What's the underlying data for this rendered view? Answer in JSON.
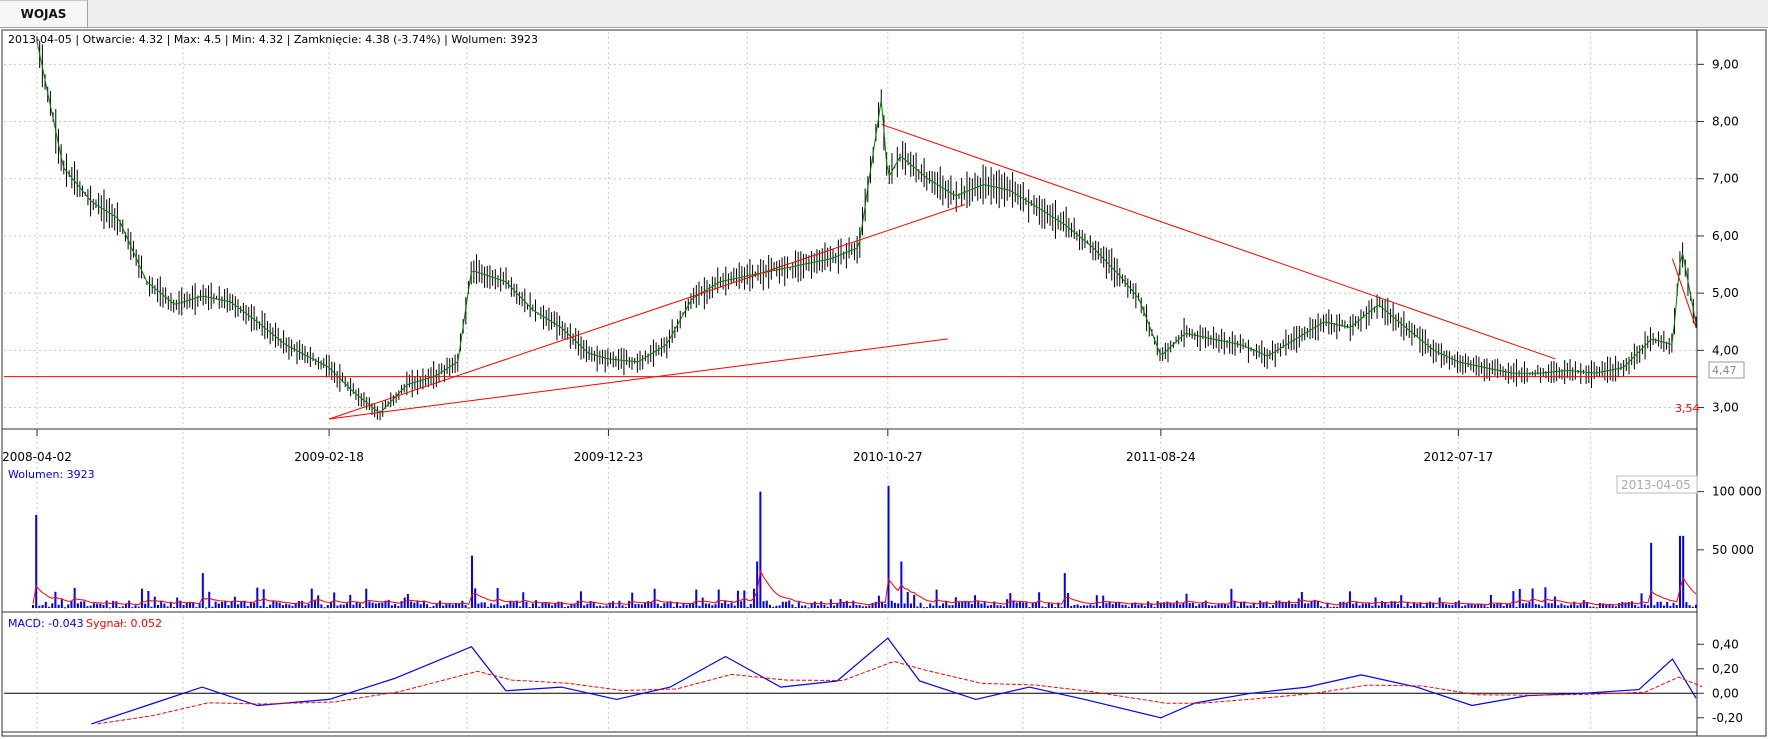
{
  "tab": {
    "label": "WOJAS"
  },
  "info_line": "2013-04-05 | Otwarcie: 4.32 | Max: 4.5 | Min: 4.32 | Zamknięcie: 4.38 (-3.74%)  | Wolumen: 3923",
  "price": {
    "y_ticks": [
      "3,00",
      "4,00",
      "5,00",
      "6,00",
      "7,00",
      "8,00",
      "9,00"
    ],
    "last_value": "4,47",
    "support_value": "3,54"
  },
  "x_labels": [
    "2008-04-02",
    "2009-02-18",
    "2009-12-23",
    "2010-10-27",
    "2011-08-24",
    "2012-07-17"
  ],
  "current_date": "2013-04-05",
  "volume": {
    "label": "Wolumen: 3923",
    "y_ticks": [
      "50 000",
      "100 000"
    ]
  },
  "macd": {
    "label": "MACD: -0.043",
    "signal_label": "Sygnał: 0.052",
    "y_ticks": [
      "-0,20",
      "0,00",
      "0,20",
      "0,40"
    ]
  },
  "colors": {
    "grid": "#c8c8c8",
    "candle": "#000000",
    "ma": "#008000",
    "trendline": "#ff0000",
    "volume": "#0000ff",
    "volume_avg": "#ff0000",
    "macd": "#0000ff",
    "signal": "#ff0000"
  },
  "chart_data": {
    "type": "line",
    "title": "WOJAS",
    "x_range": [
      "2008-04-02",
      "2013-04-05"
    ],
    "price_series": {
      "name": "Zamknięcie",
      "dates": [
        "2008-04-02",
        "2008-05-01",
        "2008-06-01",
        "2008-07-01",
        "2008-08-01",
        "2008-09-01",
        "2008-10-01",
        "2008-11-01",
        "2008-12-01",
        "2009-01-01",
        "2009-02-18",
        "2009-03-15",
        "2009-04-15",
        "2009-05-15",
        "2009-06-15",
        "2009-07-10",
        "2009-07-25",
        "2009-09-01",
        "2009-10-01",
        "2009-11-01",
        "2009-12-01",
        "2009-12-23",
        "2010-01-25",
        "2010-02-25",
        "2010-03-25",
        "2010-04-25",
        "2010-05-25",
        "2010-06-25",
        "2010-07-25",
        "2010-08-25",
        "2010-09-25",
        "2010-10-20",
        "2010-10-27",
        "2010-11-10",
        "2010-12-10",
        "2011-01-10",
        "2011-02-10",
        "2011-03-10",
        "2011-04-10",
        "2011-05-10",
        "2011-06-10",
        "2011-07-10",
        "2011-07-31",
        "2011-08-24",
        "2011-09-20",
        "2011-10-20",
        "2011-11-20",
        "2011-12-20",
        "2012-01-20",
        "2012-02-20",
        "2012-03-20",
        "2012-04-20",
        "2012-05-20",
        "2012-06-20",
        "2012-07-17",
        "2012-08-15",
        "2012-09-15",
        "2012-10-15",
        "2012-11-15",
        "2012-12-15",
        "2013-01-15",
        "2013-02-15",
        "2013-03-10",
        "2013-03-20",
        "2013-04-05"
      ],
      "values": [
        9.4,
        7.2,
        6.6,
        6.3,
        5.2,
        4.8,
        4.95,
        4.85,
        4.5,
        4.1,
        3.7,
        3.3,
        2.9,
        3.4,
        3.55,
        3.8,
        5.4,
        5.2,
        4.7,
        4.4,
        3.95,
        3.85,
        3.8,
        4.1,
        4.9,
        5.2,
        5.3,
        5.4,
        5.5,
        5.6,
        5.8,
        8.4,
        7.0,
        7.4,
        7.0,
        6.7,
        6.9,
        6.8,
        6.5,
        6.2,
        5.8,
        5.3,
        4.9,
        3.9,
        4.3,
        4.2,
        4.1,
        3.9,
        4.2,
        4.5,
        4.4,
        4.8,
        4.4,
        4.0,
        3.8,
        3.7,
        3.6,
        3.6,
        3.65,
        3.6,
        3.7,
        4.2,
        4.1,
        5.8,
        4.47
      ]
    },
    "reference_levels": [
      {
        "name": "support",
        "value": 3.54
      }
    ],
    "trendlines": [
      {
        "from": [
          "2009-02-18",
          2.8
        ],
        "to": [
          "2011-01-20",
          6.55
        ]
      },
      {
        "from": [
          "2009-02-18",
          2.8
        ],
        "to": [
          "2011-01-01",
          4.2
        ]
      },
      {
        "from": [
          "2010-10-20",
          7.95
        ],
        "to": [
          "2012-11-01",
          3.85
        ]
      },
      {
        "from": [
          "2013-03-10",
          5.6
        ],
        "to": [
          "2013-04-05",
          4.4
        ]
      }
    ],
    "ylim": [
      2.8,
      9.6
    ],
    "volume_peaks": [
      {
        "date": "2008-04-02",
        "value": 80000
      },
      {
        "date": "2008-10-01",
        "value": 30000
      },
      {
        "date": "2009-07-25",
        "value": 45000
      },
      {
        "date": "2010-06-10",
        "value": 100000
      },
      {
        "date": "2010-06-05",
        "value": 40000
      },
      {
        "date": "2010-10-27",
        "value": 105000
      },
      {
        "date": "2010-11-10",
        "value": 40000
      },
      {
        "date": "2011-05-10",
        "value": 30000
      },
      {
        "date": "2013-02-15",
        "value": 56000
      },
      {
        "date": "2013-03-20",
        "value": 62000
      }
    ],
    "volume_ylim": [
      0,
      110000
    ],
    "macd_series": {
      "name": "MACD",
      "dates": [
        "2008-06-01",
        "2008-08-01",
        "2008-10-01",
        "2008-12-01",
        "2009-02-18",
        "2009-05-01",
        "2009-07-25",
        "2009-09-01",
        "2009-11-01",
        "2010-01-01",
        "2010-03-01",
        "2010-05-01",
        "2010-07-01",
        "2010-09-01",
        "2010-10-27",
        "2010-12-01",
        "2011-02-01",
        "2011-04-01",
        "2011-06-01",
        "2011-08-24",
        "2011-10-01",
        "2011-12-01",
        "2012-02-01",
        "2012-04-01",
        "2012-06-01",
        "2012-08-01",
        "2012-10-01",
        "2012-12-01",
        "2013-02-01",
        "2013-03-10",
        "2013-04-05"
      ],
      "values": [
        -0.25,
        -0.1,
        0.05,
        -0.1,
        -0.05,
        0.12,
        0.38,
        0.02,
        0.05,
        -0.05,
        0.05,
        0.3,
        0.05,
        0.1,
        0.45,
        0.1,
        -0.05,
        0.05,
        -0.05,
        -0.2,
        -0.08,
        0.0,
        0.05,
        0.15,
        0.05,
        -0.1,
        -0.02,
        0.0,
        0.03,
        0.28,
        -0.04
      ]
    },
    "macd_ylim": [
      -0.3,
      0.5
    ]
  }
}
